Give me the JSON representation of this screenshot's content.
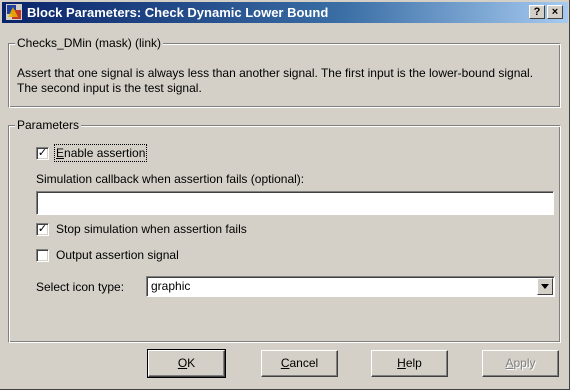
{
  "window": {
    "title": "Block Parameters: Check Dynamic  Lower Bound",
    "help_btn": "?",
    "close_btn": "×"
  },
  "description": {
    "group_label": "Checks_DMin (mask) (link)",
    "text": "Assert that one signal is always less than another signal.  The first input is the lower-bound signal.  The second input is the test signal."
  },
  "parameters": {
    "group_label": "Parameters",
    "enable_assertion": {
      "mnemonic": "E",
      "rest": "nable assertion",
      "checked": true
    },
    "callback_label": "Simulation callback when assertion fails (optional):",
    "callback_value": "",
    "stop_simulation": {
      "label": "Stop simulation when assertion fails",
      "checked": true
    },
    "output_signal": {
      "label": "Output assertion signal",
      "checked": false
    },
    "icon_type_label": "Select icon type:",
    "icon_type_value": "graphic"
  },
  "buttons": {
    "ok": {
      "mnemonic": "O",
      "rest": "K"
    },
    "cancel": {
      "mnemonic": "C",
      "rest": "ancel"
    },
    "help": {
      "mnemonic": "H",
      "rest": "elp"
    },
    "apply": {
      "mnemonic": "A",
      "rest": "pply"
    }
  },
  "colors": {
    "face": "#d4d0c8",
    "title_start": "#0a246a",
    "title_end": "#a6caf0"
  },
  "icons": [
    "simulink-app-icon",
    "question-icon",
    "close-icon",
    "check-icon",
    "chevron-down-icon"
  ]
}
